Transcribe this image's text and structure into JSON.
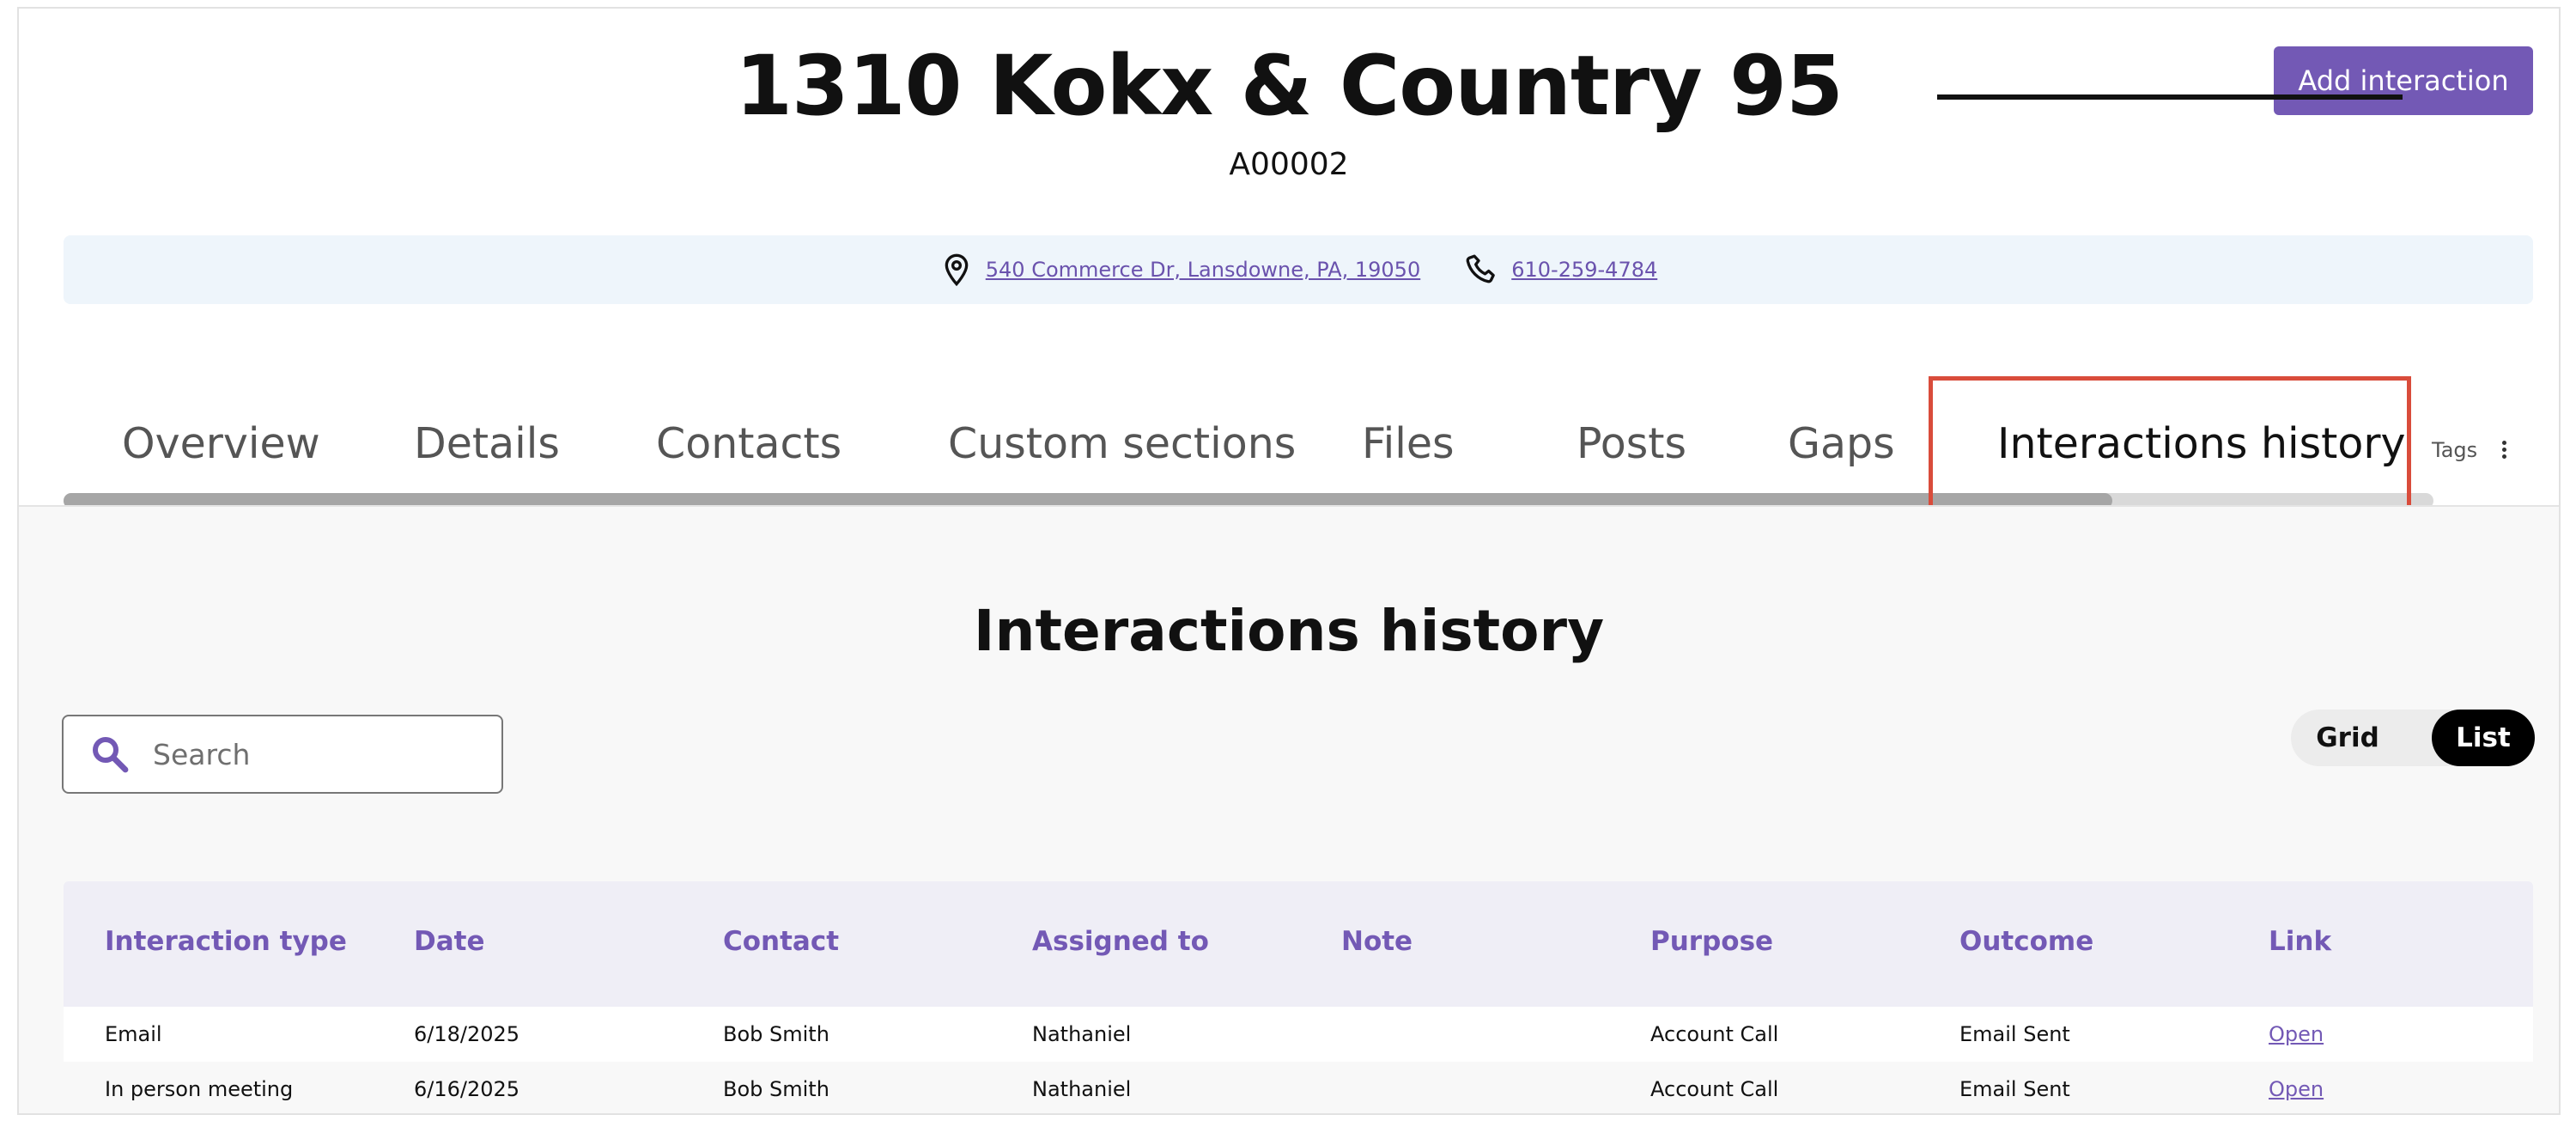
{
  "header": {
    "title": "1310 Kokx & Country 95",
    "code": "A00002",
    "add_button": "Add interaction"
  },
  "info": {
    "address": "540 Commerce Dr, Lansdowne, PA, 19050",
    "phone": "610-259-4784"
  },
  "tabs": [
    {
      "label": "Overview"
    },
    {
      "label": "Details"
    },
    {
      "label": "Contacts"
    },
    {
      "label": "Custom sections"
    },
    {
      "label": "Files"
    },
    {
      "label": "Posts"
    },
    {
      "label": "Gaps"
    },
    {
      "label": "Interactions history",
      "active": true
    }
  ],
  "tags_label": "Tags",
  "section": {
    "title": "Interactions history",
    "search_placeholder": "Search",
    "view_toggle": {
      "grid": "Grid",
      "list": "List",
      "selected": "List"
    }
  },
  "table": {
    "columns": [
      "Interaction type",
      "Date",
      "Contact",
      "Assigned to",
      "Note",
      "Purpose",
      "Outcome",
      "Link"
    ],
    "rows": [
      [
        "Email",
        "6/18/2025",
        "Bob Smith",
        "Nathaniel",
        "",
        "Account Call",
        "Email Sent",
        "Open"
      ],
      [
        "In person meeting",
        "6/16/2025",
        "Bob Smith",
        "Nathaniel",
        "",
        "Account Call",
        "Email Sent",
        "Open"
      ]
    ]
  },
  "colors": {
    "accent": "#7359b5",
    "info_bar": "#eef5fb",
    "highlight": "#d94c3b"
  }
}
